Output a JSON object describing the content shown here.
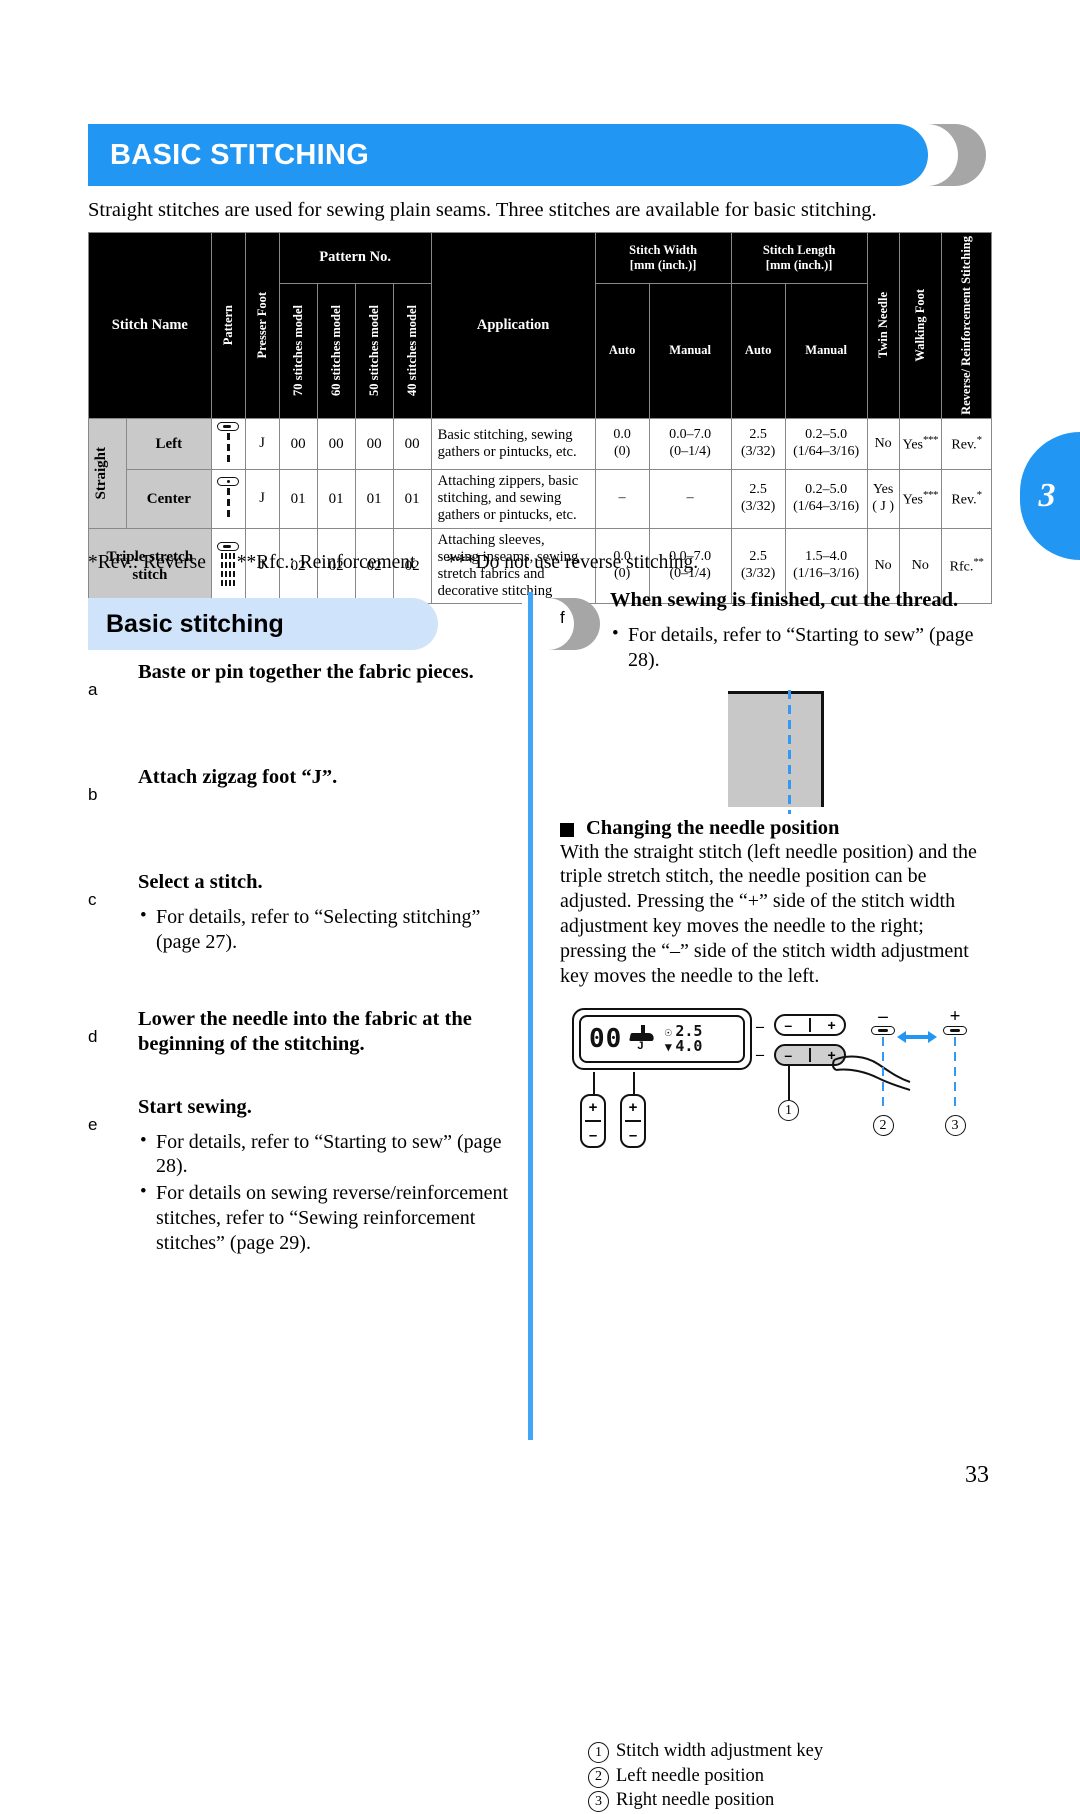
{
  "page_tab": "3",
  "page_number": "33",
  "banner": {
    "title": "BASIC STITCHING"
  },
  "intro": "Straight stitches are used for sewing plain seams. Three stitches are available for basic stitching.",
  "table": {
    "headers": {
      "stitch_name": "Stitch Name",
      "pattern": "Pattern",
      "presser_foot": "Presser Foot",
      "pattern_no": "Pattern No.",
      "model_70": "70 stitches model",
      "model_60": "60 stitches model",
      "model_50": "50 stitches model",
      "model_40": "40 stitches model",
      "application": "Application",
      "stitch_width": "Stitch Width",
      "stitch_width_unit": "[mm (inch.)]",
      "stitch_length": "Stitch Length",
      "stitch_length_unit": "[mm (inch.)]",
      "auto": "Auto",
      "manual": "Manual",
      "twin_needle": "Twin Needle",
      "walking_foot": "Walking Foot",
      "reverse_reinforcement": "Reverse/ Reinforcement Stitching"
    },
    "group_label": "Straight",
    "rows": [
      {
        "name": "Left",
        "pattern_icon": "straight-left-stitch-icon",
        "presser_foot": "J",
        "no_70": "00",
        "no_60": "00",
        "no_50": "00",
        "no_40": "00",
        "application": "Basic stitching, sewing gathers or pintucks, etc.",
        "width_auto": "0.0",
        "width_auto_in": "(0)",
        "width_manual": "0.0–7.0",
        "width_manual_in": "(0–1/4)",
        "length_auto": "2.5",
        "length_auto_in": "(3/32)",
        "length_manual": "0.2–5.0",
        "length_manual_in": "(1/64–3/16)",
        "twin_needle": "No",
        "twin_needle_sub": "",
        "walking_foot": "Yes",
        "walking_foot_ast": "***",
        "reverse": "Rev.",
        "reverse_ast": "*"
      },
      {
        "name": "Center",
        "pattern_icon": "straight-center-stitch-icon",
        "presser_foot": "J",
        "no_70": "01",
        "no_60": "01",
        "no_50": "01",
        "no_40": "01",
        "application": "Attaching zippers, basic stitching, and sewing gathers or pintucks, etc.",
        "width_auto": "–",
        "width_auto_in": "",
        "width_manual": "–",
        "width_manual_in": "",
        "length_auto": "2.5",
        "length_auto_in": "(3/32)",
        "length_manual": "0.2–5.0",
        "length_manual_in": "(1/64–3/16)",
        "twin_needle": "Yes",
        "twin_needle_sub": "( J )",
        "walking_foot": "Yes",
        "walking_foot_ast": "***",
        "reverse": "Rev.",
        "reverse_ast": "*"
      },
      {
        "name": "Triple stretch stitch",
        "pattern_icon": "triple-stretch-stitch-icon",
        "presser_foot": "J",
        "no_70": "02",
        "no_60": "02",
        "no_50": "02",
        "no_40": "02",
        "application": "Attaching sleeves, sewing inseams, sewing stretch fabrics and decorative stitching",
        "width_auto": "0.0",
        "width_auto_in": "(0)",
        "width_manual": "0.0–7.0",
        "width_manual_in": "(0–1/4)",
        "length_auto": "2.5",
        "length_auto_in": "(3/32)",
        "length_manual": "1.5–4.0",
        "length_manual_in": "(1/16–3/16)",
        "twin_needle": "No",
        "twin_needle_sub": "",
        "walking_foot": "No",
        "walking_foot_ast": "",
        "reverse": "Rfc.",
        "reverse_ast": "**"
      }
    ]
  },
  "footnotes": {
    "rev": "*Rev.: Reverse",
    "rfc": "**Rfc.: Reinforcement",
    "no_reverse": "***Do not use reverse stitching."
  },
  "subheading": {
    "title": "Basic stitching"
  },
  "steps_left": [
    {
      "marker": "a",
      "title": "Baste or pin together the fabric pieces.",
      "bullets": []
    },
    {
      "marker": "b",
      "title": "Attach zigzag foot “J”.",
      "bullets": []
    },
    {
      "marker": "c",
      "title": "Select a stitch.",
      "bullets": [
        "For details, refer to “Selecting stitching” (page 27)."
      ]
    },
    {
      "marker": "d",
      "title": "Lower the needle into the fabric at the beginning of the stitching.",
      "bullets": []
    },
    {
      "marker": "e",
      "title": "Start sewing.",
      "bullets": [
        "For details, refer to “Starting to sew” (page 28).",
        "For details on sewing reverse/reinforcement stitches, refer to “Sewing reinforcement stitches” (page 29)."
      ]
    }
  ],
  "steps_right": [
    {
      "marker": "f",
      "title": "When sewing is finished, cut the thread.",
      "bullets": [
        "For details, refer to “Starting to sew” (page 28)."
      ]
    }
  ],
  "needle_section": {
    "heading": "Changing the needle position",
    "body": "With the straight stitch (left needle position) and the triple stretch stitch, the needle position can be adjusted. Pressing the “+” side of the stitch width adjustment key moves the needle to the right; pressing the “–” side of the stitch width adjustment key moves the needle to the left."
  },
  "diagram": {
    "lcd_pattern": "00",
    "presser_foot_label": "J",
    "width_value": "2.5",
    "length_value": "4.0",
    "minus": "–",
    "plus": "+",
    "callout_1": "1",
    "callout_2": "2",
    "callout_3": "3",
    "left_needle_sign": "–",
    "right_needle_sign": "+"
  },
  "legend": [
    {
      "num": "1",
      "text": "Stitch width adjustment key"
    },
    {
      "num": "2",
      "text": "Left needle position"
    },
    {
      "num": "3",
      "text": "Right needle position"
    }
  ],
  "colors": {
    "accent": "#2196f3",
    "subbar": "#cfe4fa",
    "grey": "#a6a6a6",
    "seam": "#3399f5"
  }
}
